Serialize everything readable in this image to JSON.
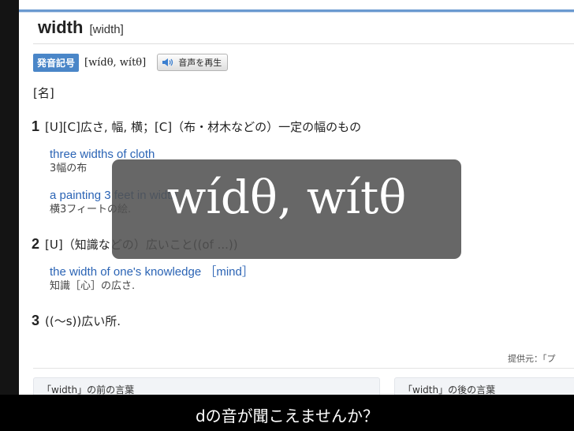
{
  "dictionary": {
    "headword": "width",
    "headword_bracket": "[width]",
    "pronunciation": {
      "badge": "発音記号",
      "ipa": "[wídθ, wítθ]",
      "audio_button": "音声を再生"
    },
    "part_of_speech": "[名]",
    "senses": [
      {
        "number": "1",
        "definition": "[U][C]広さ, 幅, 横；[C]（布・材木などの）一定の幅のもの",
        "examples": [
          {
            "en": "three widths of cloth",
            "ja": "3幅の布"
          },
          {
            "en": "a painting 3 feet in width",
            "ja": "横3フィートの絵."
          }
        ]
      },
      {
        "number": "2",
        "definition": "[U]（知識などの）広いこと((of ...))",
        "examples": [
          {
            "en": "the width of one's knowledge ［mind］",
            "ja": "知識［心］の広さ."
          }
        ]
      },
      {
        "number": "3",
        "definition": "((〜s))広い所.",
        "examples": []
      }
    ],
    "provider": "提供元：「プ",
    "previous_words_title": "「width」の前の言葉",
    "next_words_title": "「width」の後の言葉"
  },
  "overlay": {
    "text": "wídθ, wítθ"
  },
  "subtitle": "dの音が聞こえませんか？",
  "colors": {
    "accent_blue": "#4a86c8",
    "link_blue": "#2b64b5",
    "overlay_gray": "#525252",
    "caption_background": "#000000"
  },
  "icons": {
    "audio": "speaker-icon"
  }
}
